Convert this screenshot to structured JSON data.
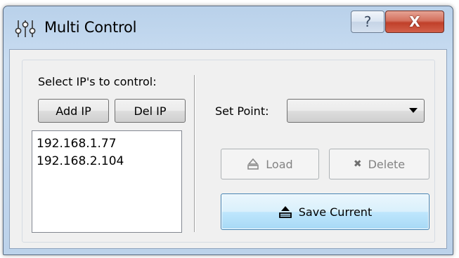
{
  "window": {
    "title": "Multi Control",
    "help_glyph": "?",
    "close_glyph": "X"
  },
  "ip_panel": {
    "label": "Select IP's to control:",
    "add_label": "Add IP",
    "del_label": "Del IP",
    "ips": [
      "192.168.1.77",
      "192.168.2.104"
    ]
  },
  "setpoint_panel": {
    "label": "Set Point:",
    "selected": "",
    "load_label": "Load",
    "delete_label": "Delete",
    "delete_glyph": "✖",
    "save_label": "Save Current"
  },
  "icons": {
    "app": "sliders-icon",
    "load": "eject-icon",
    "delete": "x-icon",
    "save": "save-icon"
  }
}
